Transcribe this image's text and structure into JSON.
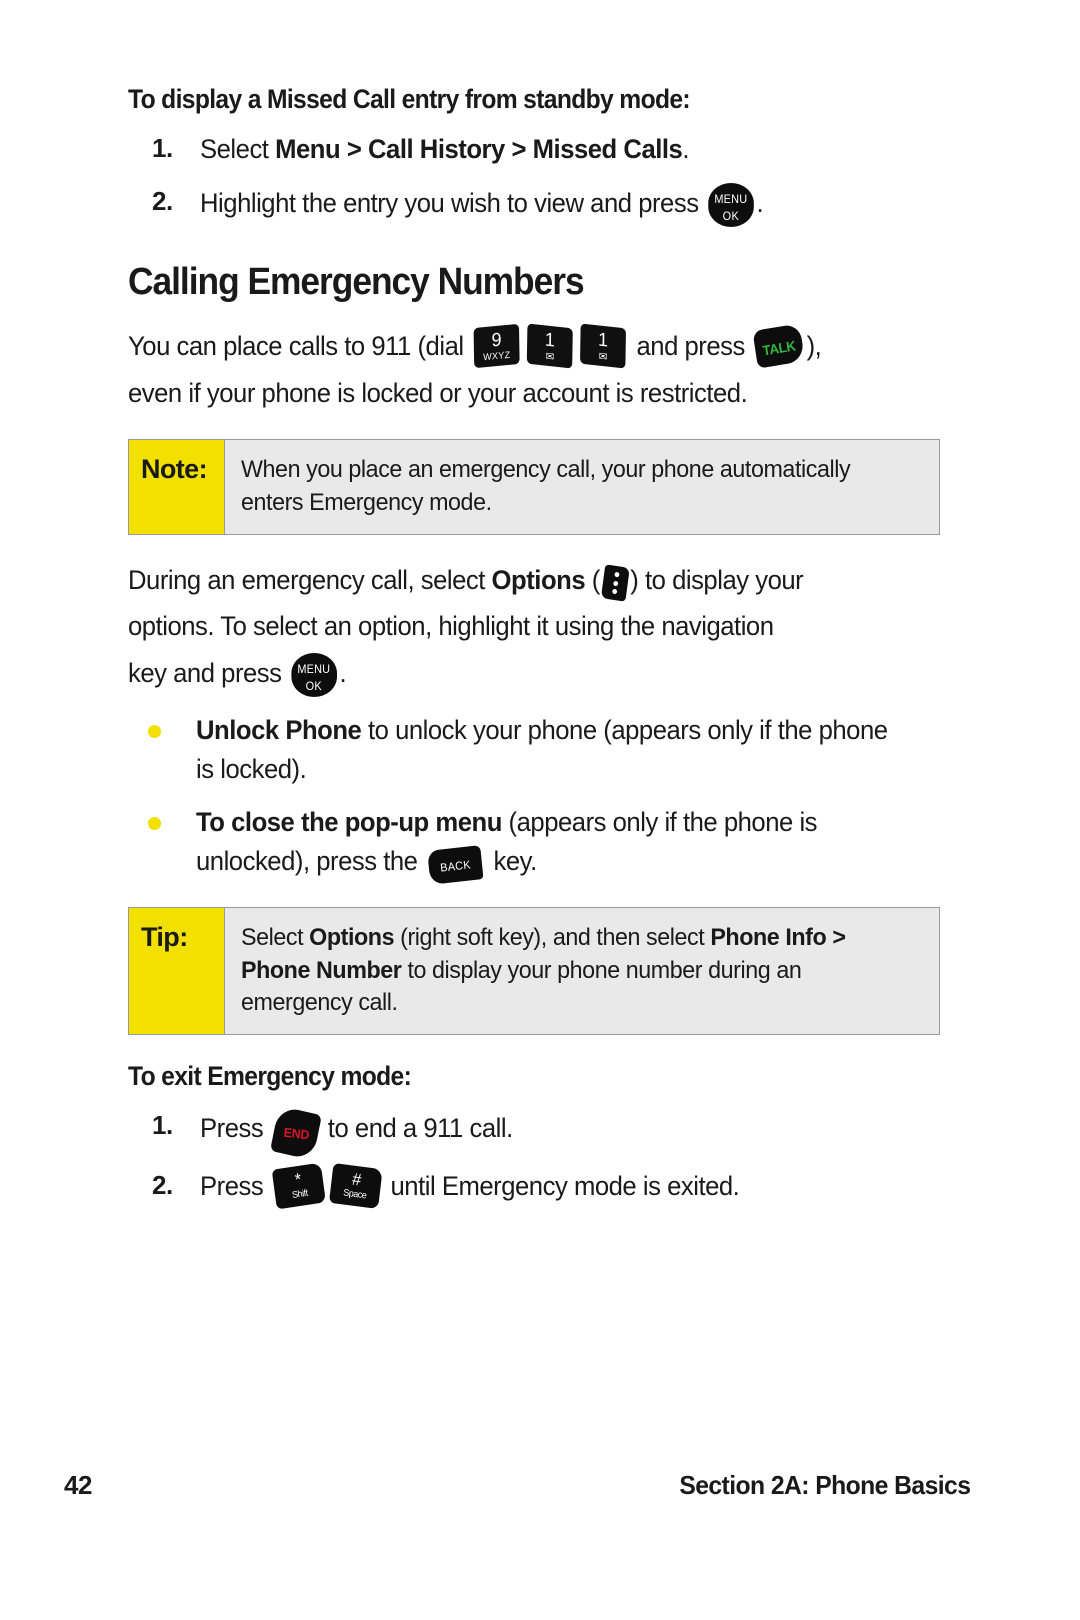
{
  "page": {
    "number": "42",
    "section_footer": "Section 2A: Phone Basics"
  },
  "colors": {
    "callout_label_bg": "#F2E000",
    "callout_body_bg": "#E9E9E9",
    "callout_border": "#9A9A9A",
    "bullet": "#F2E000",
    "talk_green": "#2FB53A",
    "end_red": "#D8152A",
    "key_black": "#0D0D0D"
  },
  "missed_call": {
    "heading": "To display a Missed Call entry from standby mode:",
    "steps": [
      {
        "number": "1.",
        "pre": "Select ",
        "bold1": "Menu",
        "sep1": " > ",
        "bold2": "Call History",
        "sep2": " > ",
        "bold3": "Missed Calls",
        "post": "."
      },
      {
        "number": "2.",
        "pre": "Highlight the entry you wish to view and press ",
        "post": "."
      }
    ]
  },
  "emergency": {
    "heading": "Calling Emergency Numbers",
    "intro_pre": "You can place calls to 911 (dial ",
    "intro_mid": " and press ",
    "intro_post": "),",
    "intro_line2": "even if your phone is locked or your account is restricted.",
    "note": {
      "label": "Note:",
      "line1": "When you place an emergency call, your phone automatically",
      "line2": "enters Emergency mode."
    },
    "options_para": {
      "pre": "During an emergency call, select ",
      "bold": "Options",
      "mid": " (",
      "after_icon": ") to display your",
      "line2": "options. To select an option, highlight it using the navigation",
      "line3_pre": "key and press ",
      "line3_post": "."
    },
    "bullets": [
      {
        "bold": "Unlock Phone",
        "rest": " to unlock your phone (appears only if the phone is locked)."
      },
      {
        "bold": "To close the pop-up menu",
        "rest_pre": " (appears only if the phone is unlocked), press the ",
        "rest_post": " key."
      }
    ],
    "tip": {
      "label": "Tip:",
      "line1_pre": "Select ",
      "line1_bold": "Options",
      "line1_mid": " (right soft key), and then select ",
      "line1_bold2": "Phone Info >",
      "line2_bold": "Phone Number",
      "line2_rest": " to display your phone number during an",
      "line3": "emergency call."
    },
    "exit": {
      "heading": "To exit Emergency mode:",
      "steps": [
        {
          "number": "1.",
          "pre": "Press ",
          "post": " to end a 911 call."
        },
        {
          "number": "2.",
          "pre": "Press ",
          "post": " until Emergency mode is exited."
        }
      ]
    }
  },
  "keys": {
    "menu_ok": {
      "line1": "MENU",
      "line2": "OK",
      "name": "menu-ok-key"
    },
    "nine": {
      "digit": "9",
      "letters": "WXYZ",
      "name": "keypad-9-key"
    },
    "one_a": {
      "digit": "1",
      "symbol": "✉",
      "name": "keypad-1-key"
    },
    "one_b": {
      "digit": "1",
      "symbol": "✉",
      "name": "keypad-1-key"
    },
    "talk": {
      "label": "TALK",
      "name": "talk-key"
    },
    "end": {
      "label": "END",
      "name": "end-key"
    },
    "back": {
      "label": "BACK",
      "name": "back-key"
    },
    "options": {
      "label": "⋮",
      "name": "options-soft-key"
    },
    "star": {
      "symbol": "*",
      "sub": "Shift",
      "name": "star-shift-key"
    },
    "pound": {
      "symbol": "#",
      "sub": "Space",
      "name": "pound-space-key"
    }
  }
}
